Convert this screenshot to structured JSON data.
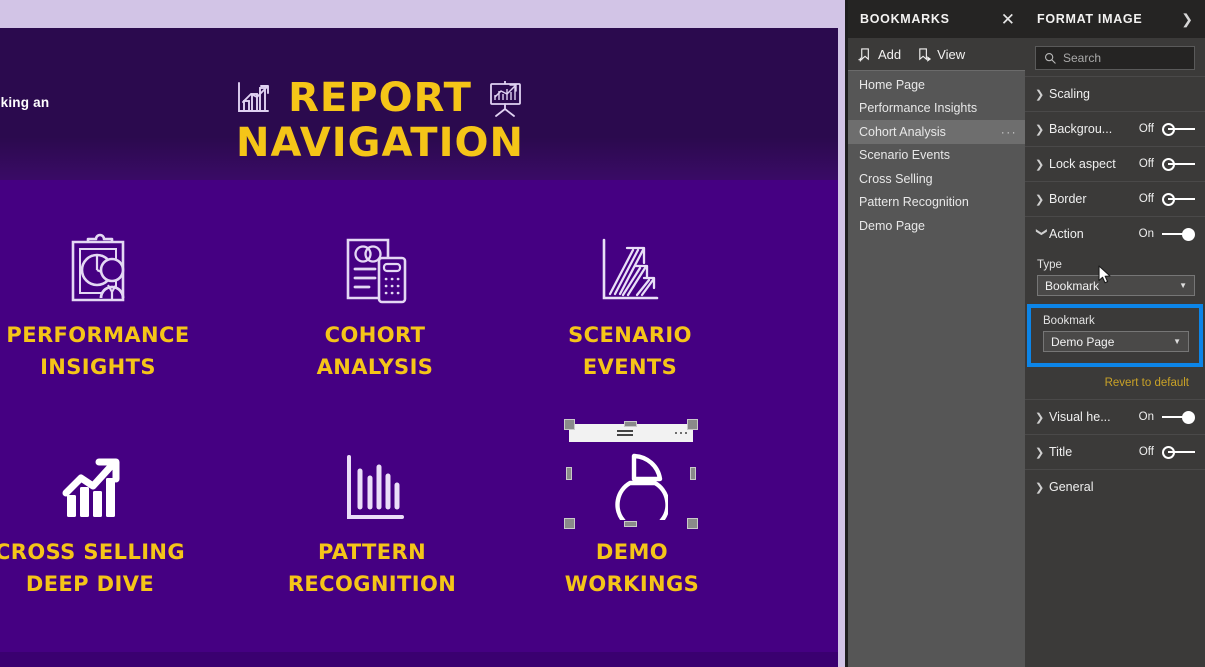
{
  "report": {
    "description_visible_fragment": "age to\ncking an",
    "title_word1": "REPORT",
    "title_word2": "NAVIGATION",
    "left_icon_name": "bar-chart-growth-icon",
    "right_icon_name": "presentation-chart-icon",
    "colors": {
      "header_band": "#2B0A4E",
      "page_background": "#450082",
      "accent_text": "#F5C518",
      "icon_stroke": "#E8DFF5",
      "canvas_border": "#D2C4E6"
    },
    "tiles": [
      {
        "label": "PERFORMANCE\nINSIGHTS",
        "icon": "clipboard-analyst-icon"
      },
      {
        "label": "COHORT\nANALYSIS",
        "icon": "report-calculator-icon"
      },
      {
        "label": "SCENARIO\nEVENTS",
        "icon": "growth-arrows-chart-icon"
      },
      {
        "label": "CROSS SELLING\nDEEP DIVE",
        "icon": "trending-up-bars-icon"
      },
      {
        "label": "PATTERN\nRECOGNITION",
        "icon": "column-chart-icon"
      },
      {
        "label": "DEMO\nWORKINGS",
        "icon": "pie-chart-window-icon"
      }
    ],
    "selected_visual": {
      "name": "DEMO WORKINGS",
      "header_menu_icon": "hamburger-icon",
      "header_more_icon": "more-options-icon",
      "selected": true
    }
  },
  "bookmarks_pane": {
    "title": "BOOKMARKS",
    "close_icon": "close-icon",
    "toolbar": [
      {
        "label": "Add",
        "icon": "add-bookmark-icon"
      },
      {
        "label": "View",
        "icon": "view-bookmark-icon"
      }
    ],
    "items": [
      {
        "label": "Home Page",
        "selected": false
      },
      {
        "label": "Performance Insights",
        "selected": false
      },
      {
        "label": "Cohort Analysis",
        "selected": true,
        "ellipsis": "···"
      },
      {
        "label": "Scenario Events",
        "selected": false
      },
      {
        "label": "Cross Selling",
        "selected": false
      },
      {
        "label": "Pattern Recognition",
        "selected": false
      },
      {
        "label": "Demo Page",
        "selected": false
      }
    ]
  },
  "format_pane": {
    "title": "FORMAT IMAGE",
    "expand_icon": "chevron-right-icon",
    "search_placeholder": "Search",
    "search_icon": "search-icon",
    "search_value": "",
    "sections": [
      {
        "label": "Scaling",
        "expanded": false,
        "has_toggle": false,
        "state": ""
      },
      {
        "label": "Backgrou...",
        "expanded": false,
        "has_toggle": true,
        "state": "Off"
      },
      {
        "label": "Lock aspect",
        "expanded": false,
        "has_toggle": true,
        "state": "Off"
      },
      {
        "label": "Border",
        "expanded": false,
        "has_toggle": true,
        "state": "Off"
      },
      {
        "label": "Action",
        "expanded": true,
        "has_toggle": true,
        "state": "On"
      }
    ],
    "action": {
      "type_label": "Type",
      "type_value": "Bookmark",
      "bookmark_label": "Bookmark",
      "bookmark_value": "Demo Page",
      "revert_label": "Revert to default",
      "highlight_color": "#0C85E8"
    },
    "sections_after": [
      {
        "label": "Visual he...",
        "expanded": false,
        "has_toggle": true,
        "state": "On"
      },
      {
        "label": "Title",
        "expanded": false,
        "has_toggle": true,
        "state": "Off"
      },
      {
        "label": "General",
        "expanded": false,
        "has_toggle": false,
        "state": ""
      }
    ]
  },
  "cursor": {
    "icon": "mouse-pointer-icon"
  }
}
